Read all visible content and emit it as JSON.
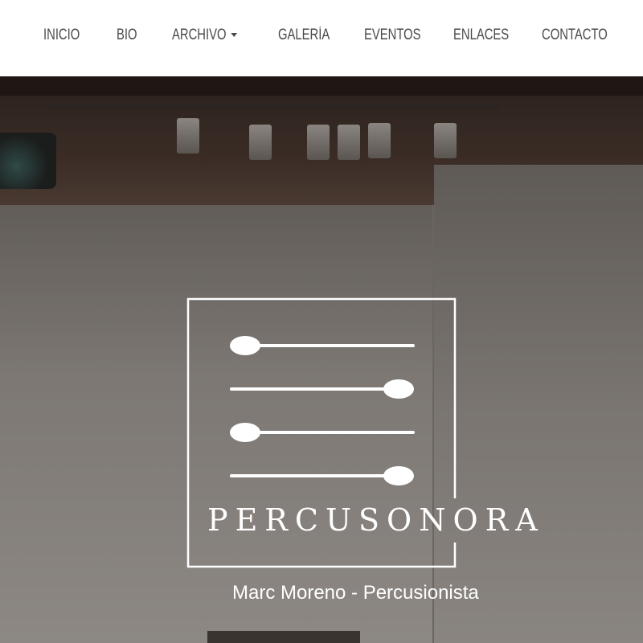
{
  "nav": {
    "items": [
      "INICIO",
      "BIO",
      "ARCHIVO",
      "GALERÍA",
      "EVENTOS",
      "ENLACES",
      "CONTACTO"
    ]
  },
  "hero": {
    "brand": "PERCUSONORA",
    "subtitle": "Marc Moreno - Percusionista"
  },
  "icons": {
    "logo": "drumstick-lines-logo",
    "dropdown": "chevron-down-icon"
  }
}
